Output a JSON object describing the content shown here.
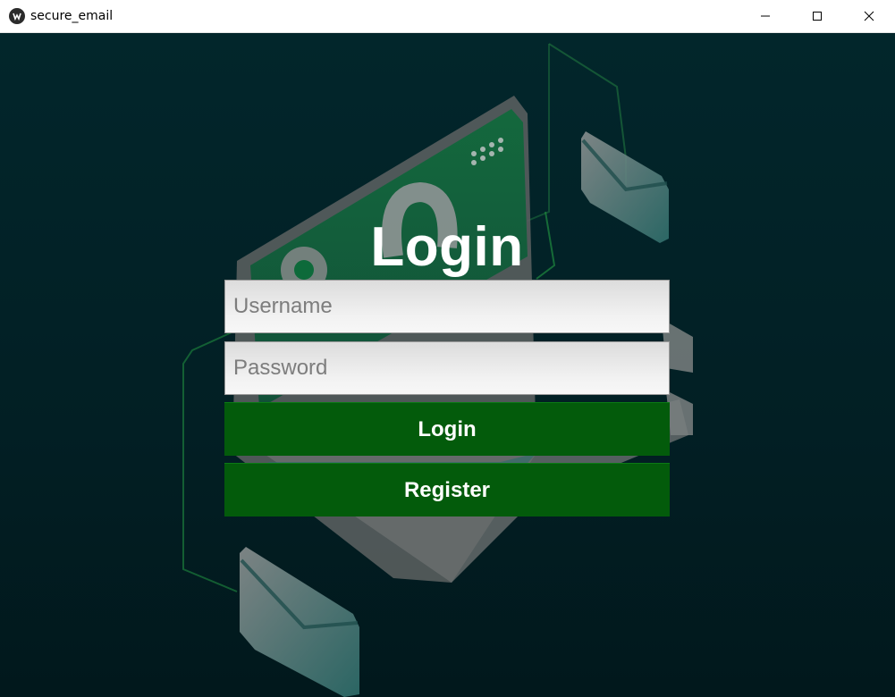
{
  "window": {
    "title": "secure_email",
    "icon": "kivy-app-icon",
    "controls": [
      "minimize-icon",
      "maximize-icon",
      "close-icon"
    ]
  },
  "login": {
    "heading": "Login",
    "username_placeholder": "Username",
    "password_placeholder": "Password",
    "login_button": "Login",
    "register_button": "Register"
  },
  "colors": {
    "background": "#02262b",
    "button": "#035b0b",
    "field": "#f2f2f2",
    "accent_green": "#1aa43a"
  }
}
